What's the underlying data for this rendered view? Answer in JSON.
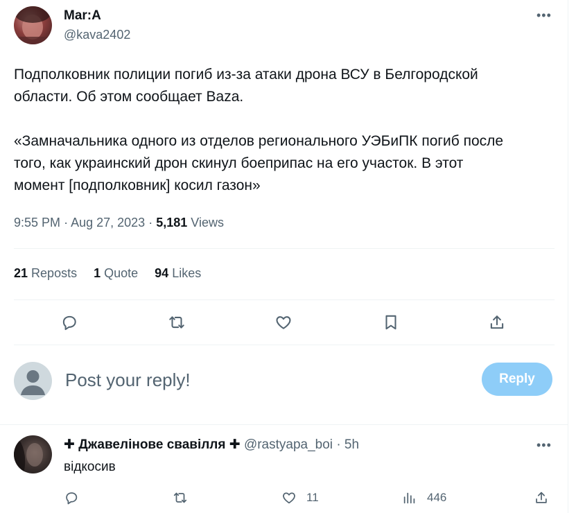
{
  "tweet": {
    "display_name": "Mar:A",
    "handle": "@kava2402",
    "text": "Подполковник полиции погиб из-за атаки дрона ВСУ в Белгородской\nобласти. Об этом сообщает Baza.\n\n«Замначальника одного из отделов регионального УЭБиПК погиб после\nтого, как украинский дрон скинул боеприпас на его участок. В этот\nмомент [подполковник] косил газон»",
    "time": "9:55 PM",
    "date": "Aug 27, 2023",
    "separator": "·",
    "views_count": "5,181",
    "views_label": "Views"
  },
  "stats": {
    "reposts_count": "21",
    "reposts_label": "Reposts",
    "quotes_count": "1",
    "quotes_label": "Quote",
    "likes_count": "94",
    "likes_label": "Likes"
  },
  "actions": {
    "reply_icon": "reply-icon",
    "repost_icon": "repost-icon",
    "like_icon": "like-icon",
    "bookmark_icon": "bookmark-icon",
    "share_icon": "share-icon"
  },
  "composer": {
    "placeholder": "Post your reply!",
    "button_label": "Reply",
    "button_color": "#8ecdf8"
  },
  "reply": {
    "display_name": "✚ Джавелінове свавілля ✚",
    "handle": "@rastyapa_boi",
    "separator": "·",
    "age": "5h",
    "text": "відкосив",
    "likes": "11",
    "views": "446"
  },
  "colors": {
    "text": "#0f1419",
    "muted": "#536471",
    "divider": "#eff3f4",
    "accent": "#1d9bf0"
  }
}
